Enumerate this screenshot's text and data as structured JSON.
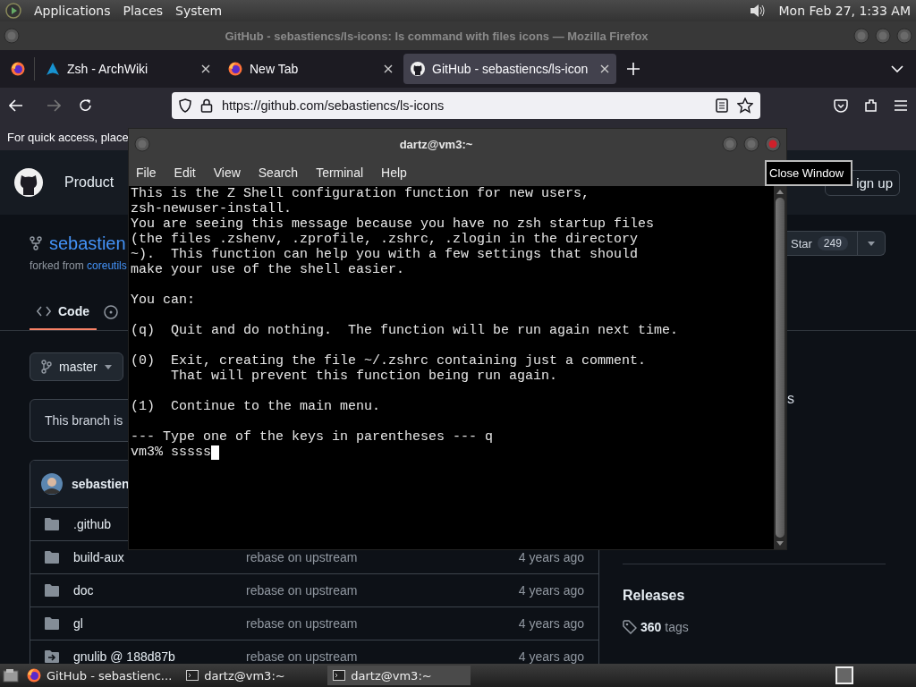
{
  "top_panel": {
    "menus": [
      "Applications",
      "Places",
      "System"
    ],
    "clock": "Mon Feb 27, 1:33 AM"
  },
  "browser": {
    "title": "GitHub - sebastiencs/ls-icons: ls command with files icons — Mozilla Firefox",
    "tabs": [
      {
        "label": "Zsh - ArchWiki",
        "selected": false
      },
      {
        "label": "New Tab",
        "selected": false
      },
      {
        "label": "GitHub - sebastiencs/ls-icon",
        "selected": true
      }
    ],
    "url": "https://github.com/sebastiencs/ls-icons",
    "bookmarks_hint": "For quick access, place"
  },
  "github": {
    "nav": "Product",
    "signup": "ign up",
    "repo_name": "sebastien",
    "forked_prefix": "forked from",
    "forked_link": "coreutils",
    "star_label": "Star",
    "star_count": "249",
    "tab": {
      "label": "Code",
      "selected": true
    },
    "branch": "master",
    "flash": "This branch is",
    "sidebar_fragment": "s",
    "last_committer": "sebastien",
    "files": [
      {
        "name": ".github",
        "kind": "folder"
      },
      {
        "name": "build-aux",
        "kind": "folder",
        "message": "rebase on upstream",
        "age": "4 years ago"
      },
      {
        "name": "doc",
        "kind": "folder",
        "message": "rebase on upstream",
        "age": "4 years ago"
      },
      {
        "name": "gl",
        "kind": "folder",
        "message": "rebase on upstream",
        "age": "4 years ago"
      },
      {
        "name": "gnulib @ 188d87b",
        "kind": "submodule",
        "message": "rebase on upstream",
        "age": "4 years ago"
      }
    ],
    "releases_title": "Releases",
    "tags_count": "360",
    "tags_label": "tags"
  },
  "terminal": {
    "title": "dartz@vm3:~",
    "menu": [
      "File",
      "Edit",
      "View",
      "Search",
      "Terminal",
      "Help"
    ],
    "output": "This is the Z Shell configuration function for new users,\nzsh-newuser-install.\nYou are seeing this message because you have no zsh startup files\n(the files .zshenv, .zprofile, .zshrc, .zlogin in the directory\n~).  This function can help you with a few settings that should\nmake your use of the shell easier.\n\nYou can:\n\n(q)  Quit and do nothing.  The function will be run again next time.\n\n(0)  Exit, creating the file ~/.zshrc containing just a comment.\n     That will prevent this function being run again.\n\n(1)  Continue to the main menu.\n\n--- Type one of the keys in parentheses --- q",
    "prompt": "vm3% sssss"
  },
  "tooltip": "Close Window",
  "taskbar": {
    "items": [
      {
        "label": "GitHub - sebastienc...",
        "selected": false
      },
      {
        "label": "dartz@vm3:~",
        "selected": false
      },
      {
        "label": "dartz@vm3:~",
        "selected": true
      }
    ]
  }
}
